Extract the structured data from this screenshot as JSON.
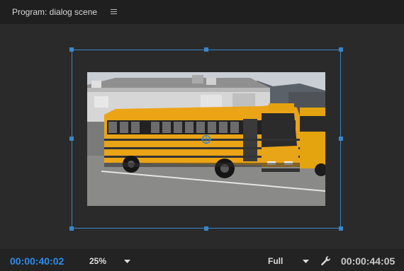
{
  "panel": {
    "title": "Program: dialog scene",
    "menu_icon": "hamburger-menu-icon"
  },
  "viewer": {
    "image_subject": "yellow-school-bus"
  },
  "controls": {
    "current_timecode": "00:00:40:02",
    "zoom_level": "25%",
    "playback_resolution": "Full",
    "settings_icon": "wrench-icon",
    "duration_timecode": "00:00:44:05"
  },
  "colors": {
    "accent": "#2d8ceb",
    "selection_box": "#3a86c8",
    "panel_bg": "#232323"
  }
}
